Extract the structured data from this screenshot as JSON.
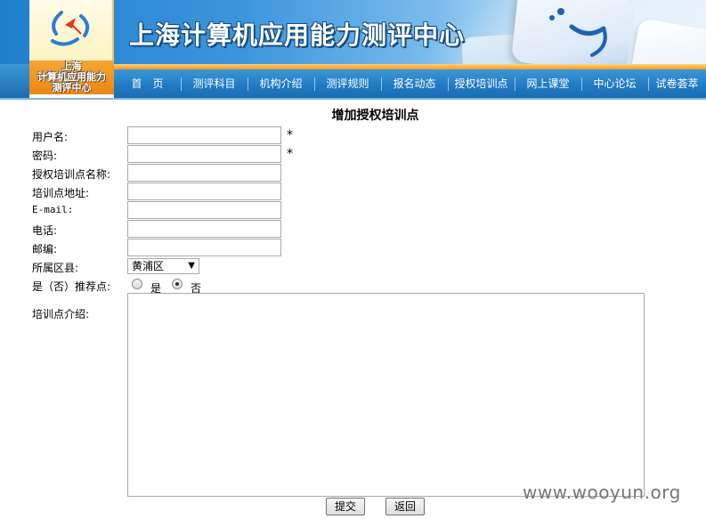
{
  "header": {
    "site_title": "上海计算机应用能力测评中心",
    "logo_lines": [
      "上海",
      "计算机应用能力",
      "测评中心"
    ]
  },
  "nav": {
    "items": [
      "首　页",
      "测评科目",
      "机构介绍",
      "测评规则",
      "报名动态",
      "授权培训点",
      "网上课堂",
      "中心论坛",
      "试卷荟萃"
    ]
  },
  "form": {
    "title": "增加授权培训点",
    "fields": {
      "username": {
        "label": "用户名:",
        "value": "",
        "required_mark": "*"
      },
      "password": {
        "label": "密码:",
        "value": "",
        "required_mark": "*"
      },
      "center_name": {
        "label": "授权培训点名称:",
        "value": ""
      },
      "address": {
        "label": "培训点地址:",
        "value": ""
      },
      "email": {
        "label": "E-mail:",
        "value": ""
      },
      "phone": {
        "label": "电话:",
        "value": ""
      },
      "zipcode": {
        "label": "邮编:",
        "value": ""
      },
      "district": {
        "label": "所属区县:",
        "selected": "黄浦区"
      },
      "recommend": {
        "label": "是（否）推荐点:",
        "options": [
          "是",
          "否"
        ],
        "selected": "否"
      },
      "intro": {
        "label": "培训点介绍:",
        "value": ""
      }
    },
    "buttons": {
      "submit": "提交",
      "back": "返回"
    }
  },
  "watermark": "www.wooyun.org"
}
